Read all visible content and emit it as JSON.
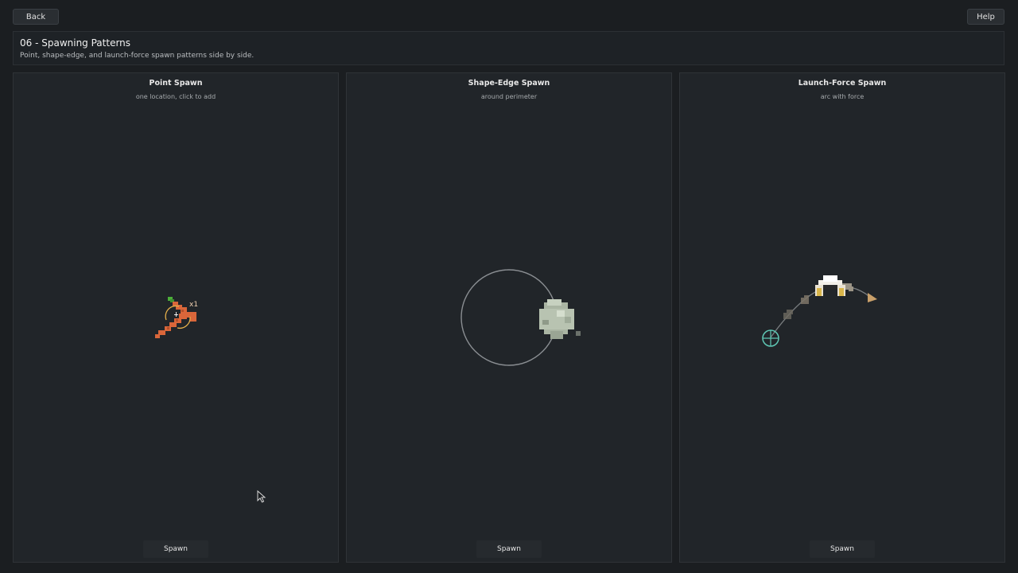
{
  "toolbar": {
    "back_label": "Back",
    "help_label": "Help"
  },
  "header": {
    "title": "06 - Spawning Patterns",
    "subtitle": "Point, shape-edge, and launch-force spawn patterns side by side."
  },
  "panels": [
    {
      "title": "Point Spawn",
      "subtitle": "one location, click to add",
      "spawn_label": "Spawn",
      "counter": "x1"
    },
    {
      "title": "Shape-Edge Spawn",
      "subtitle": "around perimeter",
      "spawn_label": "Spawn"
    },
    {
      "title": "Launch-Force Spawn",
      "subtitle": "arc with force",
      "spawn_label": "Spawn"
    }
  ],
  "icons": {
    "point_item": "carrot-icon",
    "shape_item": "rock-icon",
    "launch_item": "bone-icon",
    "launch_origin": "crosshair-icon",
    "launch_direction": "arrow-icon",
    "cursor": "mouse-pointer-icon"
  },
  "colors": {
    "background": "#1b1e21",
    "panel": "#212529",
    "carrot": "#d9663a",
    "leaf": "#4caf3a",
    "rock": "#b7c2b0",
    "origin": "#5fc7b4",
    "arrow": "#c9a06a"
  }
}
